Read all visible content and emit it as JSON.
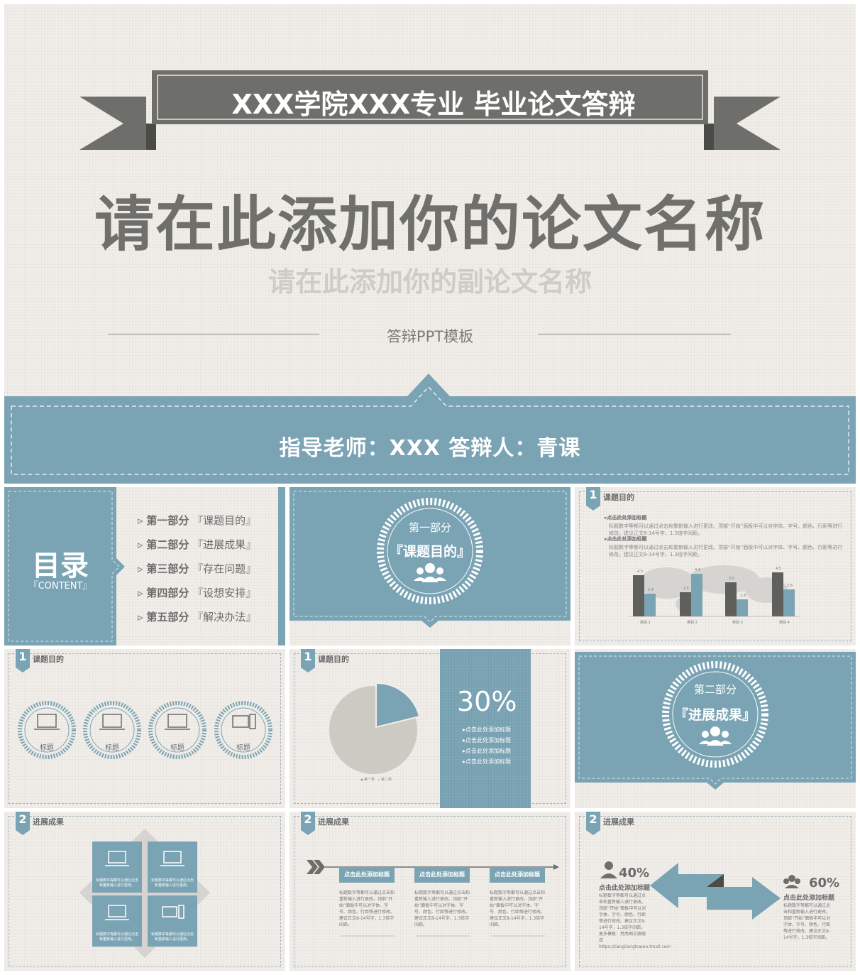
{
  "hero": {
    "banner": "XXX学院XXX专业 毕业论文答辩",
    "title": "请在此添加你的论文名称",
    "subtitle": "请在此添加你的副论文名称",
    "template_label": "答辩PPT模板",
    "advisor_line": "指导老师：XXX  答辩人：青课"
  },
  "toc": {
    "title": "目录",
    "title_en": "『CONTENT』",
    "items": [
      {
        "part": "第一部分",
        "name": "『课题目的』"
      },
      {
        "part": "第二部分",
        "name": "『进展成果』"
      },
      {
        "part": "第三部分",
        "name": "『存在问题』"
      },
      {
        "part": "第四部分",
        "name": "『设想安排』"
      },
      {
        "part": "第五部分",
        "name": "『解决办法』"
      }
    ]
  },
  "section1": {
    "label": "第一部分",
    "name": "『课题目的』"
  },
  "section2": {
    "label": "第二部分",
    "name": "『进展成果』"
  },
  "slide_bar": {
    "num": "1",
    "tag": "课题目的",
    "head1": "点击此处添加标题",
    "head2": "点击此处添加标题",
    "body": "标题数字等都可以通过点击和重新输入进行更改。顶部“开始”面板中可以对字体、字号、颜色、行距等进行修改。建议正文8-14号字，1.3倍字间距。",
    "bar_labels": [
      "类别 1",
      "类别 2",
      "类别 3",
      "类别 4"
    ],
    "value_labels": [
      "4.3",
      "2.4",
      "2.5",
      "4.4",
      "3.5",
      "1.8",
      "4.5",
      "2.8"
    ]
  },
  "slide_icons": {
    "num": "1",
    "tag": "课题目的",
    "labels": [
      "标题",
      "标题",
      "标题",
      "标题"
    ]
  },
  "slide_pie": {
    "num": "1",
    "tag": "课题目的",
    "percent": "30%",
    "items": [
      "点击此处添加标题",
      "点击此处添加标题",
      "点击此处添加标题",
      "点击此处添加标题"
    ],
    "legend": [
      "第一类",
      "第二类"
    ]
  },
  "slide_squares": {
    "num": "2",
    "tag": "进展成果",
    "text": "标题数字等都可以通过点击和重新输入进行更改。"
  },
  "slide_timeline": {
    "num": "2",
    "tag": "进展成果",
    "heads": [
      "点击此处添加标题",
      "点击此处添加标题",
      "点击此处添加标题"
    ],
    "body": "标题数字等都可以通过点击和重新输入进行更改。顶部“开始”面板中可以对字体、字号、颜色、行距等进行修改。建议正文8-14号字，1.3倍字间距。"
  },
  "slide_arrows": {
    "num": "2",
    "tag": "进展成果",
    "left_pct": "40%",
    "right_pct": "60%",
    "left_head": "点击此处添加标题",
    "right_head": "点击此处添加标题",
    "left_body": "标题数字等都可以通过点击和重新输入进行更改。顶部“开始”面板中可以对字体、字号、颜色、行距等进行修改。建议正文8-14号字，1.3倍字间距。更多模板：亮亮图文旗舰店 https://liangliangtuwen.tmall.com",
    "right_body": "标题数字等都可以通过点击和重新输入进行更改。顶部“开始”面板中可以对字体、字号、颜色、行距等进行修改。建议正文8-14号字，1.3倍字间距。"
  },
  "colors": {
    "accent": "#7aa3b4",
    "ribbon": "#6e6e6a",
    "paper": "#f1eee9"
  }
}
